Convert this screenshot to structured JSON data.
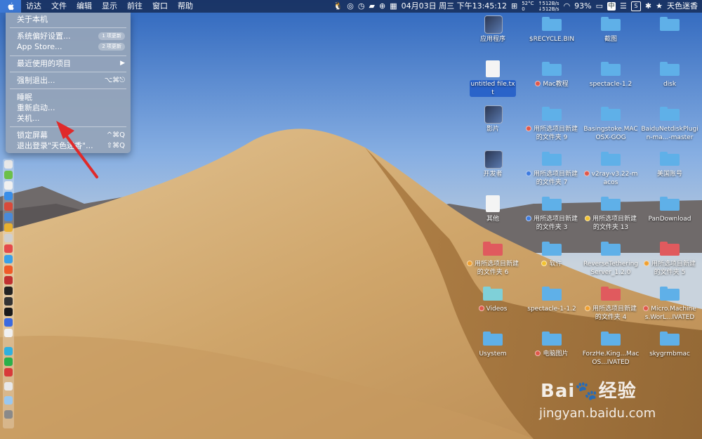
{
  "menubar": {
    "app_items": [
      "访达",
      "文件",
      "编辑",
      "显示",
      "前往",
      "窗口",
      "帮助"
    ],
    "temperature": "52°C",
    "fan": "0",
    "net_up": "↑512B/s",
    "net_down": "↓512B/s",
    "datetime": "04月03日 周三 下午13:45:12",
    "battery": "93%",
    "ime": "中",
    "user": "天色迷香"
  },
  "apple_menu": {
    "about": "关于本机",
    "prefs": "系统偏好设置...",
    "prefs_badge": "1 项更新",
    "appstore": "App Store...",
    "appstore_badge": "2 项更新",
    "recent": "最近使用的项目",
    "force_quit": "强制退出...",
    "force_quit_shortcut": "⌥⌘⎋",
    "sleep": "睡眠",
    "restart": "重新启动...",
    "shutdown": "关机...",
    "lock": "锁定屏幕",
    "lock_shortcut": "^⌘Q",
    "logout": "退出登录\"天色迷香\"...",
    "logout_shortcut": "⇧⌘Q"
  },
  "desktop": {
    "icons": [
      {
        "name": "应用程序",
        "type": "app",
        "tag": null
      },
      {
        "name": "$RECYCLE.BIN",
        "type": "folder",
        "tag": null
      },
      {
        "name": "截图",
        "type": "folder",
        "tag": null
      },
      {
        "name": "",
        "type": "folder",
        "tag": null
      },
      {
        "name": "untitled file.txt",
        "type": "file",
        "tag": null
      },
      {
        "name": "Mac教程",
        "type": "folder",
        "tag": "#e0584a"
      },
      {
        "name": "spectacle-1.2",
        "type": "folder",
        "tag": null
      },
      {
        "name": "disk",
        "type": "folder",
        "tag": null
      },
      {
        "name": "影片",
        "type": "app",
        "tag": null
      },
      {
        "name": "用所选项目新建的文件夹 9",
        "type": "folder",
        "tag": "#e0584a"
      },
      {
        "name": "Basingstoke.MACOSX-GOG",
        "type": "folder",
        "tag": null
      },
      {
        "name": "BaiduNetdiskPlugin-ma...-master",
        "type": "folder",
        "tag": null
      },
      {
        "name": "开发者",
        "type": "app",
        "tag": null
      },
      {
        "name": "用所选项目新建的文件夹 7",
        "type": "folder",
        "tag": "#3d7be0"
      },
      {
        "name": "v2ray-v3.22-macos",
        "type": "folder",
        "tag": "#e0584a"
      },
      {
        "name": "美国账号",
        "type": "folder",
        "tag": null
      },
      {
        "name": "其他",
        "type": "file",
        "tag": null
      },
      {
        "name": "用所选项目新建的文件夹 3",
        "type": "folder",
        "tag": "#3d7be0"
      },
      {
        "name": "用所选项目新建的文件夹 13",
        "type": "folder",
        "tag": "#f2c230"
      },
      {
        "name": "PanDownload",
        "type": "folder",
        "tag": null
      },
      {
        "name": "用所选项目新建的文件夹 6",
        "type": "folder-red",
        "tag": "#f0a030"
      },
      {
        "name": "软件",
        "type": "folder",
        "tag": "#f2c230"
      },
      {
        "name": "ReverseTetheringServer_1.2.0",
        "type": "folder",
        "tag": null
      },
      {
        "name": "用所选项目新建的文件夹 5",
        "type": "folder-red",
        "tag": "#f0a030"
      },
      {
        "name": "Videos",
        "type": "folder-teal",
        "tag": "#e0584a"
      },
      {
        "name": "spectacle-1-1.2",
        "type": "folder",
        "tag": null
      },
      {
        "name": "用所选项目新建的文件夹 4",
        "type": "folder-red",
        "tag": "#f0a030"
      },
      {
        "name": "Micro.Machines.WorL...IVATED",
        "type": "folder",
        "tag": "#e0584a"
      },
      {
        "name": "Usystem",
        "type": "folder",
        "tag": null
      },
      {
        "name": "电脑图片",
        "type": "folder",
        "tag": "#e0584a"
      },
      {
        "name": "ForzHe.King...MacOS...IVATED",
        "type": "folder",
        "tag": null
      },
      {
        "name": "skygrmbmac",
        "type": "folder",
        "tag": null
      }
    ]
  },
  "watermark": {
    "brand": "Bai🐾经验",
    "url": "jingyan.baidu.com"
  },
  "colors": {
    "menu_highlight": "#3d79d6",
    "folder": "#5fb0e8",
    "folder_red": "#e05a5e",
    "annotation_arrow": "#e02a2a"
  }
}
